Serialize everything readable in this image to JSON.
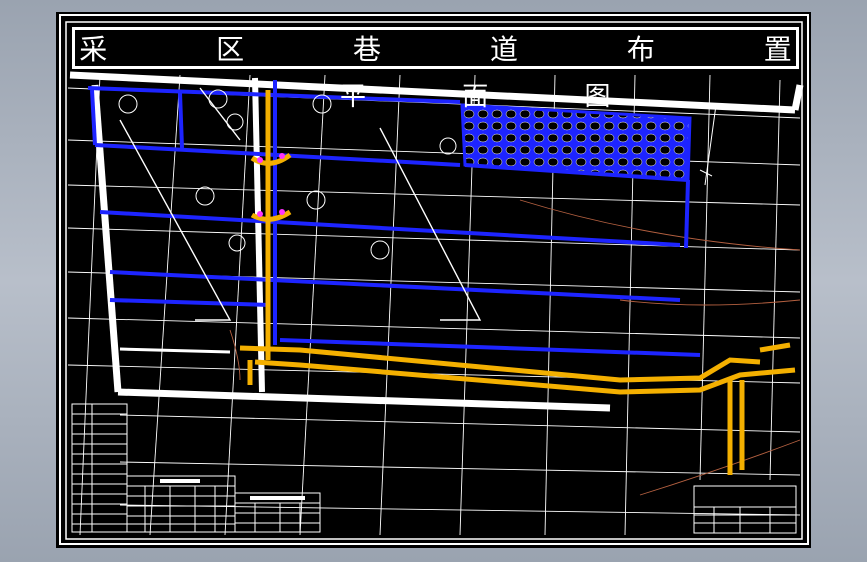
{
  "drawing": {
    "title": "采 区 巷 道 布 置",
    "subtitle": "平 面 图"
  },
  "colors": {
    "background": "#000000",
    "frame": "#ffffff",
    "grid": "#ffffff",
    "roadway_blue": "#1d24ff",
    "roadway_yellow": "#f4b000",
    "contour": "#b46040",
    "goaf_fill": "#1d24ff",
    "marker_magenta": "#ff33ff"
  }
}
